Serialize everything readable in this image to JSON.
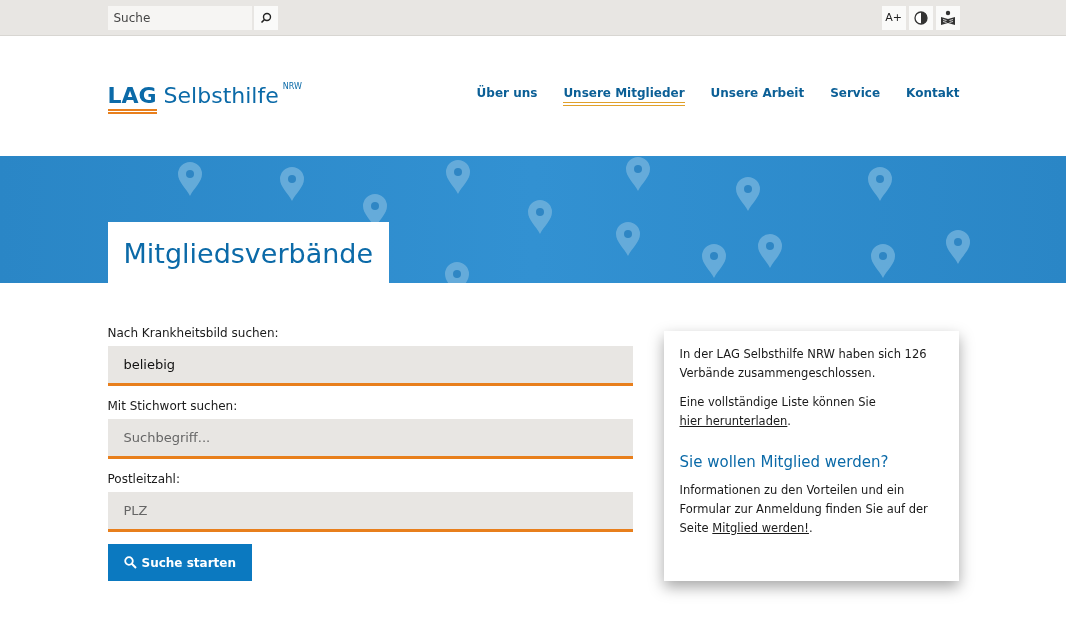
{
  "top_bar": {
    "search": {
      "placeholder": "Suche"
    },
    "font_size_button": "A+"
  },
  "logo": {
    "name": "LAG",
    "name_rest": "Selbsthilfe",
    "superscript": "NRW"
  },
  "nav": [
    {
      "label": "Über uns",
      "selected": false
    },
    {
      "label": "Unsere Mitglieder",
      "selected": true
    },
    {
      "label": "Unsere Arbeit",
      "selected": false
    },
    {
      "label": "Service",
      "selected": false
    },
    {
      "label": "Kontakt",
      "selected": false
    }
  ],
  "page_title": "Mitgliedsverbände",
  "form": {
    "fields": [
      {
        "label": "Nach Krankheitsbild suchen:",
        "value": "beliebig"
      },
      {
        "label": "Mit Stichwort suchen:",
        "placeholder": "Suchbegriff..."
      },
      {
        "label": "Postleitzahl:",
        "placeholder": "PLZ"
      }
    ],
    "submit": "Suche starten"
  },
  "info_box": {
    "paragraphs": [
      [
        {
          "kind": "text",
          "text": "In der LAG Selbsthilfe NRW haben sich 126 Verbände zusammengeschlossen."
        }
      ],
      [
        {
          "kind": "text",
          "text": "Eine vollständige Liste können Sie "
        },
        {
          "kind": "link",
          "text": "hier herunterladen"
        },
        {
          "kind": "text",
          "text": "."
        }
      ]
    ],
    "heading": "Sie wollen Mitglied werden?",
    "paragraphs_2": [
      [
        {
          "kind": "text",
          "text": "Informationen zu den Vorteilen und ein Formular zur Anmeldung finden Sie auf der Seite "
        },
        {
          "kind": "link",
          "text": "Mitglied werden!"
        },
        {
          "kind": "text",
          "text": "."
        }
      ]
    ]
  }
}
